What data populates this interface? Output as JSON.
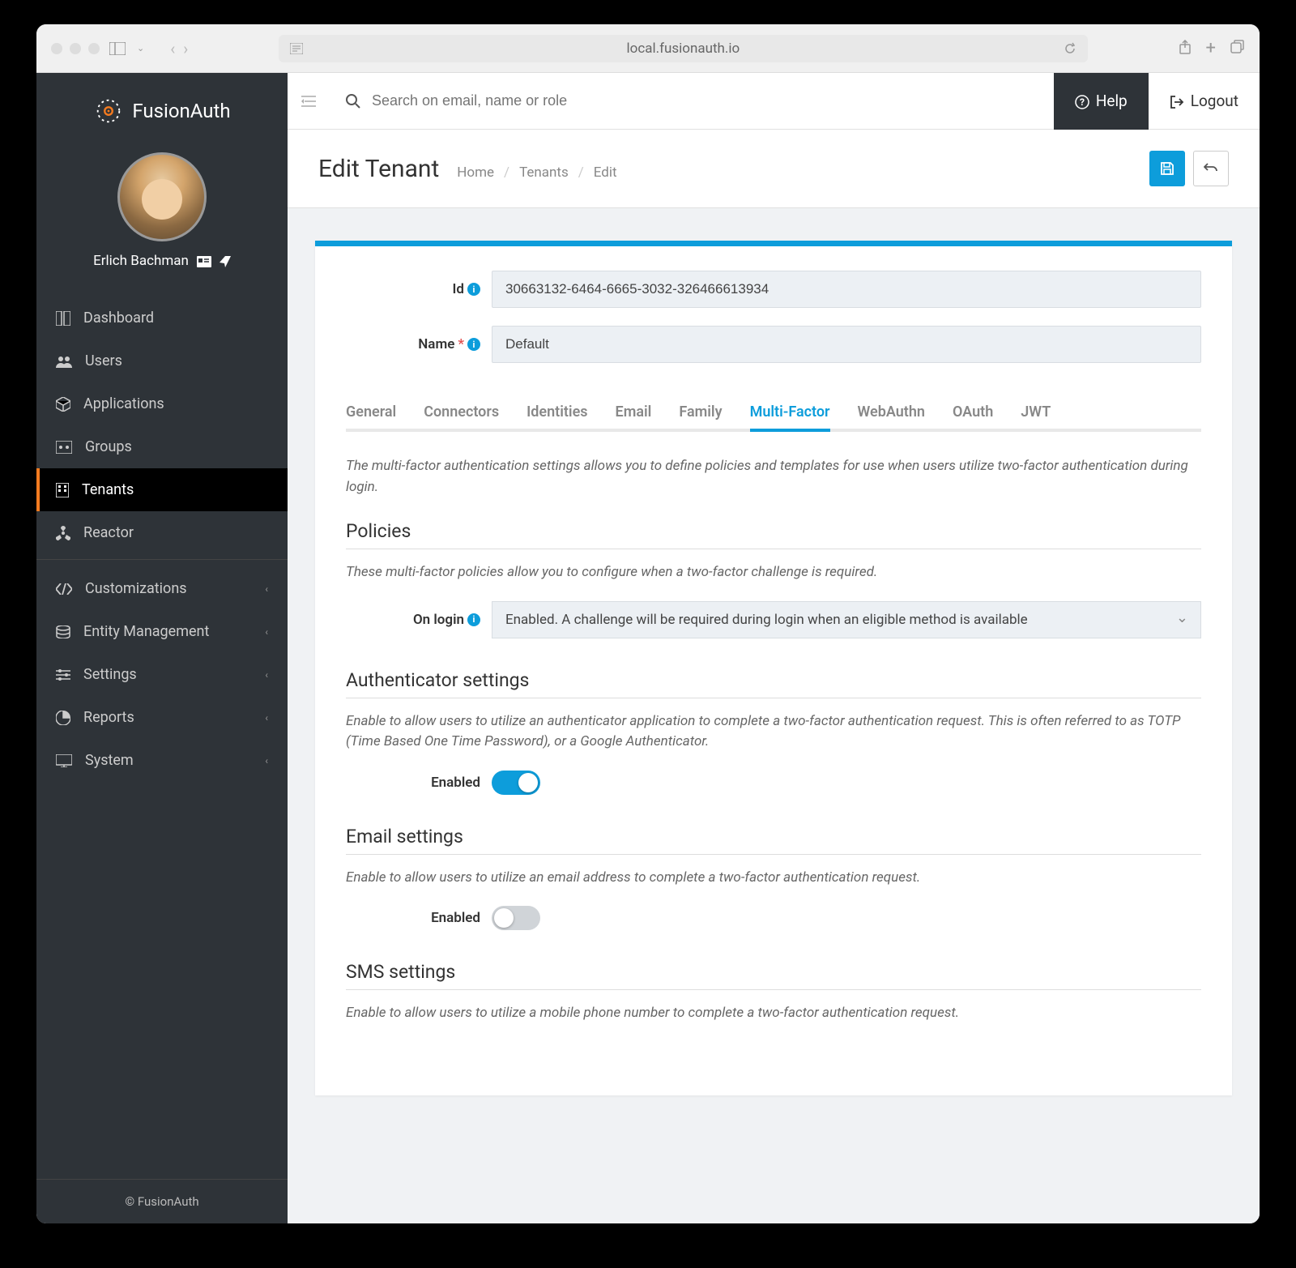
{
  "browser": {
    "url": "local.fusionauth.io"
  },
  "logo_text": "FusionAuth",
  "user": {
    "name": "Erlich Bachman"
  },
  "sidebar": {
    "items": [
      {
        "label": "Dashboard"
      },
      {
        "label": "Users"
      },
      {
        "label": "Applications"
      },
      {
        "label": "Groups"
      },
      {
        "label": "Tenants"
      },
      {
        "label": "Reactor"
      },
      {
        "label": "Customizations"
      },
      {
        "label": "Entity Management"
      },
      {
        "label": "Settings"
      },
      {
        "label": "Reports"
      },
      {
        "label": "System"
      }
    ],
    "footer": "© FusionAuth"
  },
  "topbar": {
    "search_placeholder": "Search on email, name or role",
    "help_label": "Help",
    "logout_label": "Logout"
  },
  "header": {
    "title": "Edit Tenant",
    "breadcrumb": [
      "Home",
      "Tenants",
      "Edit"
    ]
  },
  "form": {
    "id_label": "Id",
    "id_value": "30663132-6464-6665-3032-326466613934",
    "name_label": "Name",
    "name_value": "Default"
  },
  "tabs": [
    "General",
    "Connectors",
    "Identities",
    "Email",
    "Family",
    "Multi-Factor",
    "WebAuthn",
    "OAuth",
    "JWT"
  ],
  "active_tab": "Multi-Factor",
  "mfa": {
    "intro": "The multi-factor authentication settings allows you to define policies and templates for use when users utilize two-factor authentication during login.",
    "policies": {
      "title": "Policies",
      "desc": "These multi-factor policies allow you to configure when a two-factor challenge is required.",
      "on_login_label": "On login",
      "on_login_value": "Enabled. A challenge will be required during login when an eligible method is available"
    },
    "authenticator": {
      "title": "Authenticator settings",
      "desc": "Enable to allow users to utilize an authenticator application to complete a two-factor authentication request. This is often referred to as TOTP (Time Based One Time Password), or a Google Authenticator.",
      "enabled_label": "Enabled",
      "enabled": true
    },
    "email": {
      "title": "Email settings",
      "desc": "Enable to allow users to utilize an email address to complete a two-factor authentication request.",
      "enabled_label": "Enabled",
      "enabled": false
    },
    "sms": {
      "title": "SMS settings",
      "desc": "Enable to allow users to utilize a mobile phone number to complete a two-factor authentication request."
    }
  }
}
